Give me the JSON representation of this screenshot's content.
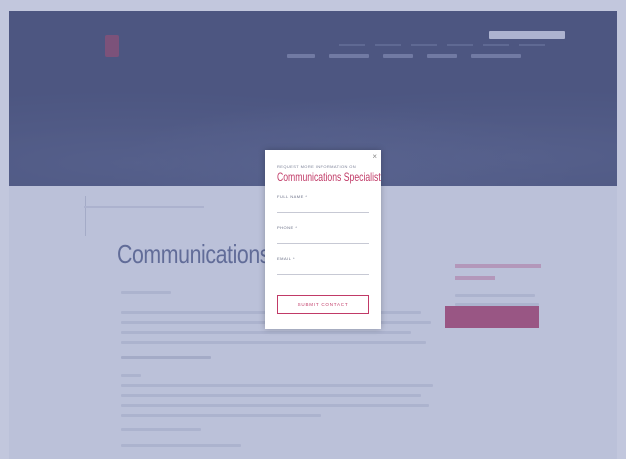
{
  "page": {
    "title": "Communications Sp"
  },
  "modal": {
    "eyebrow": "REQUEST MORE INFORMATION ON",
    "title": "Communications Specialist",
    "close_glyph": "×",
    "fields": [
      {
        "label": "FULL NAME *",
        "value": ""
      },
      {
        "label": "PHONE *",
        "value": ""
      },
      {
        "label": "EMAIL *",
        "value": ""
      }
    ],
    "submit_label": "SUBMIT CONTACT"
  },
  "colors": {
    "accent": "#c13a67",
    "header": "#2a3258",
    "overlay": "#7882b4"
  }
}
